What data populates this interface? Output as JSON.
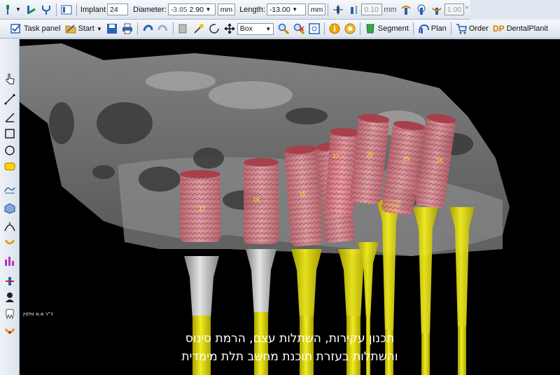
{
  "toolbar1": {
    "implant_label": "Implant",
    "implant_value": "24",
    "diameter_label": "Diameter:",
    "diameter_prefix": "-3.85",
    "diameter_value": "2.90",
    "diameter_unit": "mm",
    "length_label": "Length:",
    "length_value": "-13.00",
    "length_unit": "mm",
    "offset_value": "0.10",
    "offset_unit": "mm",
    "ratio_value": "1.00",
    "ratio_unit": "°"
  },
  "toolbar2": {
    "task_panel": "Task panel",
    "start": "Start",
    "view_mode": "Box",
    "segment": "Segment",
    "plan": "Plan",
    "order": "Order",
    "dp_logo": "DP",
    "dentalplanit": "DentalPlanit"
  },
  "implants": [
    {
      "label": "17"
    },
    {
      "label": "16"
    },
    {
      "label": "15"
    },
    {
      "label": "14"
    },
    {
      "label": "27"
    },
    {
      "label": "26"
    },
    {
      "label": "25"
    },
    {
      "label": "24"
    }
  ],
  "caption": {
    "line1": "תכנון עקירות, השתלות עצם, הרמת סינוס",
    "line2": "והשתלות בעזרת תוכנת מחשב תלת מימדית"
  },
  "signature": "ד\"ר א.א וולפין",
  "colors": {
    "implant_body": "#e48a93",
    "abutment_yellow": "#e8e000",
    "abutment_gray": "#c9c9c9",
    "bone": "#8d8d8d"
  }
}
